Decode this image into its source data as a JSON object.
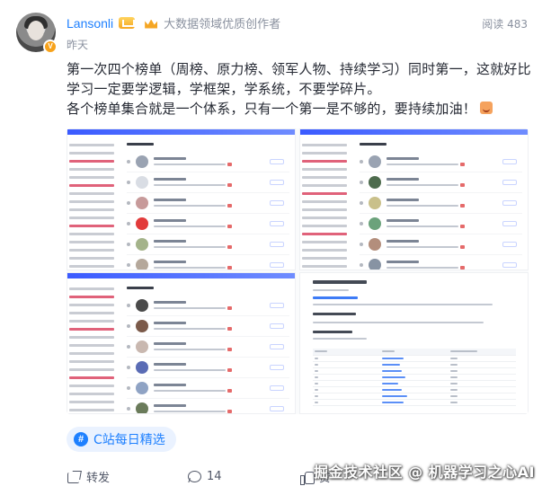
{
  "author": {
    "name": "Lansonli",
    "title": "大数据领域优质创作者",
    "time": "昨天"
  },
  "stats": {
    "views": "阅读 483"
  },
  "content": {
    "line1": "第一次四个榜单（周榜、原力榜、领军人物、持续学习）同时第一，这就好比学习一定要学逻辑，学框架，学系统，不要学碎片。",
    "line2": "各个榜单集合就是一个体系，只有一个第一是不够的，要持续加油！"
  },
  "topic": {
    "label": "C站每日精选"
  },
  "actions": {
    "share_label": "转发",
    "comment_count": "14",
    "like_label": "赞"
  },
  "watermark": "掘金技术社区 @ 机器学习之心AI",
  "colors": {
    "link": "#1e80ff",
    "muted": "#8a919f",
    "text": "#252933"
  },
  "icons": [
    "avatar",
    "verified-badge-icon",
    "level-icon",
    "crown-icon",
    "hash-icon",
    "share-icon",
    "comment-icon",
    "like-icon",
    "smile-emoji-icon"
  ]
}
